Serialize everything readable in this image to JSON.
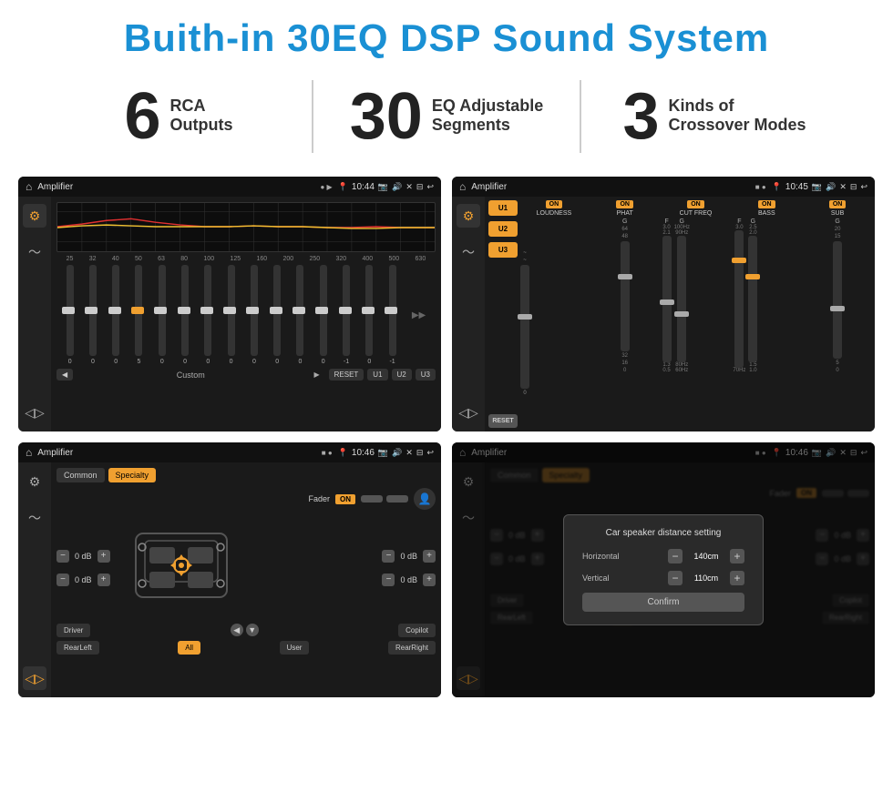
{
  "page": {
    "title": "Buith-in 30EQ DSP Sound System",
    "title_color": "#1a90d4"
  },
  "stats": [
    {
      "number": "6",
      "line1": "RCA",
      "line2": "Outputs"
    },
    {
      "number": "30",
      "line1": "EQ Adjustable",
      "line2": "Segments"
    },
    {
      "number": "3",
      "line1": "Kinds of",
      "line2": "Crossover Modes"
    }
  ],
  "screen1": {
    "app_name": "Amplifier",
    "time": "10:44",
    "eq_labels": [
      "25",
      "32",
      "40",
      "50",
      "63",
      "80",
      "100",
      "125",
      "160",
      "200",
      "250",
      "320",
      "400",
      "500",
      "630"
    ],
    "eq_values": [
      "0",
      "0",
      "0",
      "5",
      "0",
      "0",
      "0",
      "0",
      "0",
      "0",
      "0",
      "0",
      "-1",
      "0",
      "-1"
    ],
    "mode": "Custom",
    "buttons": [
      "RESET",
      "U1",
      "U2",
      "U3"
    ]
  },
  "screen2": {
    "app_name": "Amplifier",
    "time": "10:45",
    "presets": [
      "U1",
      "U2",
      "U3"
    ],
    "channels": [
      {
        "name": "LOUDNESS",
        "on": true
      },
      {
        "name": "PHAT",
        "on": true
      },
      {
        "name": "CUT FREQ",
        "on": true
      },
      {
        "name": "BASS",
        "on": true
      },
      {
        "name": "SUB",
        "on": true
      }
    ],
    "reset_label": "RESET"
  },
  "screen3": {
    "app_name": "Amplifier",
    "time": "10:46",
    "tabs": [
      "Common",
      "Specialty"
    ],
    "active_tab": "Specialty",
    "fader_label": "Fader",
    "fader_on": "ON",
    "vol_rows": [
      {
        "label": "0 dB",
        "side": "left"
      },
      {
        "label": "0 dB",
        "side": "left"
      },
      {
        "label": "0 dB",
        "side": "right"
      },
      {
        "label": "0 dB",
        "side": "right"
      }
    ],
    "bottom_btns": [
      "Driver",
      "Copilot",
      "RearLeft",
      "RearRight"
    ],
    "all_btn": "All",
    "user_btn": "User"
  },
  "screen4": {
    "app_name": "Amplifier",
    "time": "10:46",
    "tabs": [
      "Common",
      "Specialty"
    ],
    "fader_label": "Fader",
    "fader_on": "ON",
    "dialog": {
      "title": "Car speaker distance setting",
      "horizontal_label": "Horizontal",
      "horizontal_value": "140cm",
      "vertical_label": "Vertical",
      "vertical_value": "110cm",
      "confirm_label": "Confirm"
    },
    "bottom_btns_labels": {
      "driver": "Driver",
      "copilot": "Copilot",
      "rear_left": "RearLeft",
      "rear_right": "RearRight"
    },
    "vol_rows_right": [
      "0 dB",
      "0 dB"
    ]
  }
}
